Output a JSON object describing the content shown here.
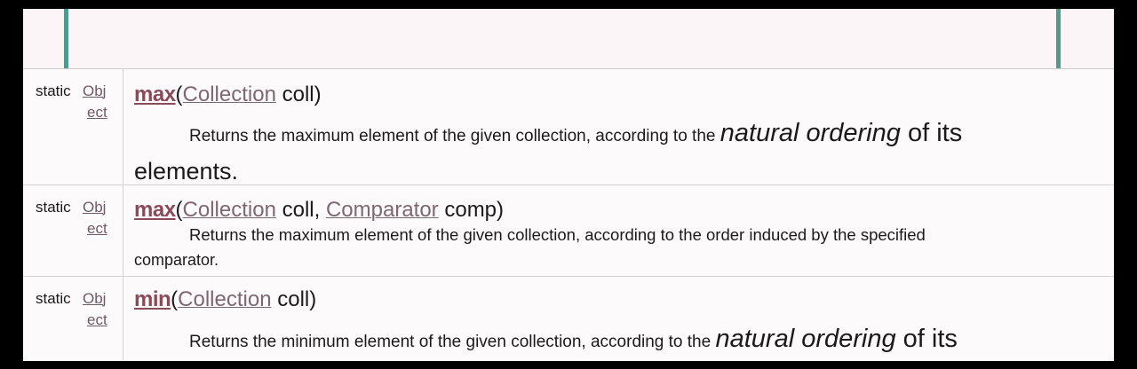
{
  "rows": [
    {
      "modifier": "static",
      "type_part1": "Obj",
      "type_part2": "ect",
      "method": "max",
      "open_paren": "(",
      "param1_type": "Collection",
      "param1_name": " coll",
      "comma": ", ",
      "param2_type": "",
      "param2_name": "",
      "close_paren": ")",
      "desc_line1_prefix": "Returns the maximum element of the given collection, according to the ",
      "desc_line1_italic": "natural ordering",
      "desc_line1_suffix": " of its",
      "desc_line2": "elements."
    },
    {
      "modifier": "static",
      "type_part1": "Obj",
      "type_part2": "ect",
      "method": "max",
      "open_paren": "(",
      "param1_type": "Collection",
      "param1_name": " coll, ",
      "param2_type": "Comparator",
      "param2_name": " comp",
      "close_paren": ")",
      "desc_line1_prefix": "Returns the maximum element of the given collection, according to the order induced by the specified",
      "desc_line2": "comparator."
    },
    {
      "modifier": "static",
      "type_part1": "Obj",
      "type_part2": "ect",
      "method": "min",
      "open_paren": "(",
      "param1_type": "Collection",
      "param1_name": " coll",
      "close_paren": ")",
      "desc_line1_prefix": "Returns the minimum element of the given collection, according to the ",
      "desc_line1_italic": "natural ordering",
      "desc_line1_suffix": " of its"
    }
  ]
}
